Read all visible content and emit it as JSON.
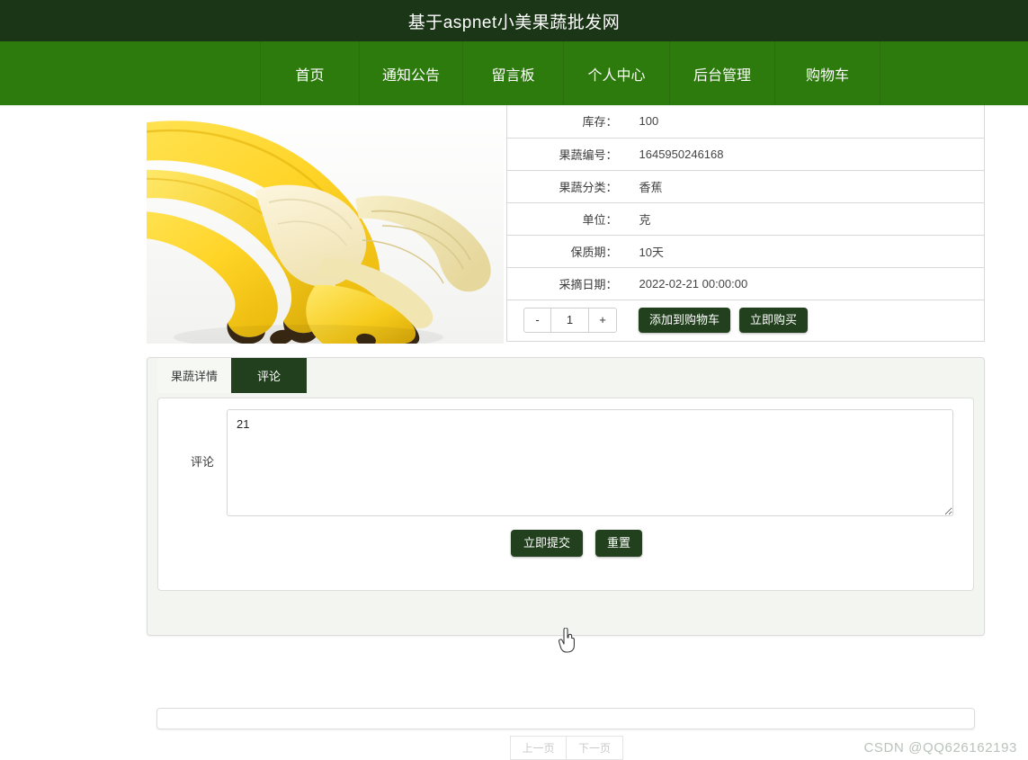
{
  "site": {
    "title": "基于aspnet小美果蔬批发网"
  },
  "nav": {
    "items": [
      {
        "label": "首页",
        "name": "nav-home"
      },
      {
        "label": "通知公告",
        "name": "nav-notice"
      },
      {
        "label": "留言板",
        "name": "nav-message-board"
      },
      {
        "label": "个人中心",
        "name": "nav-user-center"
      },
      {
        "label": "后台管理",
        "name": "nav-admin"
      },
      {
        "label": "购物车",
        "name": "nav-cart"
      }
    ]
  },
  "product": {
    "image_alt": "香蕉",
    "specs": [
      {
        "key": "库存：",
        "value": "100"
      },
      {
        "key": "果蔬编号：",
        "value": "1645950246168"
      },
      {
        "key": "果蔬分类：",
        "value": "香蕉"
      },
      {
        "key": "单位：",
        "value": "克"
      },
      {
        "key": "保质期：",
        "value": "10天"
      },
      {
        "key": "采摘日期：",
        "value": "2022-02-21 00:00:00"
      }
    ],
    "quantity": {
      "minus": "-",
      "value": "1",
      "plus": "+"
    },
    "add_to_cart": "添加到购物车",
    "buy_now": "立即购买"
  },
  "tabs": [
    {
      "label": "果蔬详情",
      "active": false
    },
    {
      "label": "评论",
      "active": true
    }
  ],
  "comment_form": {
    "label": "评论",
    "value": "21",
    "placeholder": "",
    "submit": "立即提交",
    "reset": "重置"
  },
  "pager": {
    "prev": "上一页",
    "next": "下一页"
  },
  "watermark": "CSDN @QQ626162193",
  "colors": {
    "header": "#1b3517",
    "nav": "#2d7a0d",
    "button_dark": "#22401d",
    "panel": "#f3f5f1"
  }
}
